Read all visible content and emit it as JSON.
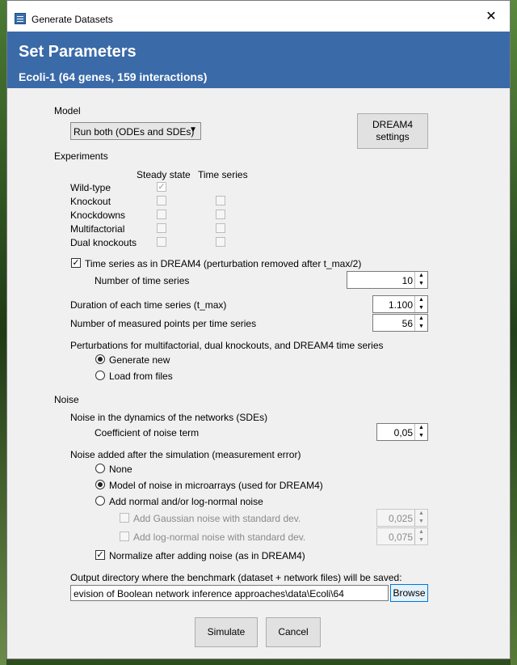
{
  "window": {
    "title": "Generate Datasets",
    "close_glyph": "✕"
  },
  "banner": {
    "title": "Set Parameters",
    "subtitle": "Ecoli-1 (64 genes, 159 interactions)"
  },
  "model": {
    "label": "Model",
    "selected": "Run both (ODEs and SDEs)",
    "dream4_button_line1": "DREAM4",
    "dream4_button_line2": "settings"
  },
  "experiments": {
    "label": "Experiments",
    "col_steady": "Steady state",
    "col_timeseries": "Time series",
    "rows": [
      {
        "label": "Wild-type",
        "steady": true,
        "timeseries": null
      },
      {
        "label": "Knockout",
        "steady": false,
        "timeseries": false
      },
      {
        "label": "Knockdowns",
        "steady": false,
        "timeseries": false
      },
      {
        "label": "Multifactorial",
        "steady": false,
        "timeseries": false
      },
      {
        "label": "Dual knockouts",
        "steady": false,
        "timeseries": false
      }
    ],
    "dream4_timeseries_label": "Time series as in DREAM4 (perturbation removed after t_max/2)",
    "num_timeseries_label": "Number of time series",
    "num_timeseries_value": "10",
    "duration_label": "Duration of each time series (t_max)",
    "duration_value": "1.100",
    "points_label": "Number of measured points per time series",
    "points_value": "56",
    "perturbations_label": "Perturbations for multifactorial, dual knockouts, and DREAM4 time series",
    "perturb_generate": "Generate new",
    "perturb_load": "Load from files"
  },
  "noise": {
    "label": "Noise",
    "dynamics_label": "Noise in the dynamics of the networks (SDEs)",
    "coef_label": "Coefficient of noise term",
    "coef_value": "0,05",
    "after_label": "Noise added after the simulation (measurement error)",
    "opt_none": "None",
    "opt_microarray": "Model of noise in microarrays (used for DREAM4)",
    "opt_normal": "Add normal and/or log-normal noise",
    "gaussian_label": "Add Gaussian noise with standard dev.",
    "gaussian_value": "0,025",
    "lognormal_label": "Add log-normal noise with standard dev.",
    "lognormal_value": "0,075",
    "normalize_label": "Normalize after adding noise (as in DREAM4)"
  },
  "output": {
    "label": "Output directory where the benchmark (dataset + network files) will be saved:",
    "path": "evision of Boolean network inference approaches\\data\\Ecoli\\64",
    "browse": "Browse"
  },
  "footer": {
    "simulate": "Simulate",
    "cancel": "Cancel"
  }
}
